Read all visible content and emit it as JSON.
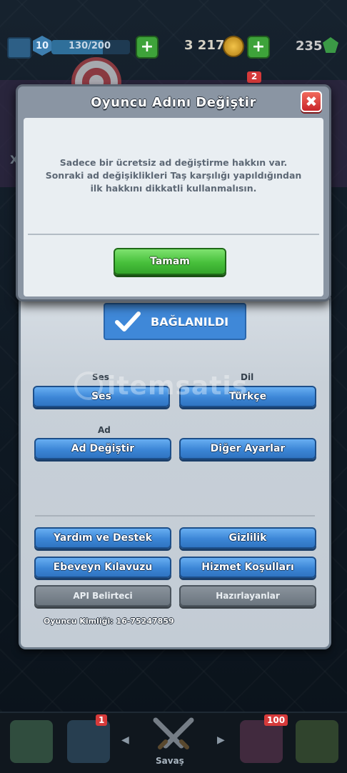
{
  "topbar": {
    "level": "10",
    "xp_text": "130/200",
    "xp_progress": 0.65,
    "gold": "3 217",
    "gems": "235"
  },
  "background": {
    "chest_badge": "2",
    "side_mark": "X"
  },
  "modal": {
    "title": "Oyuncu Adını Değiştir",
    "close_label": "✖",
    "message": "Sadece bir ücretsiz ad değiştirme hakkın var. Sonraki ad değişiklikleri Taş karşılığı yapıldığından ilk hakkını dikkatli kullanmalısın.",
    "ok_label": "Tamam"
  },
  "settings": {
    "connected_label": "BAĞLANILDI",
    "sound_section": "Ses",
    "language_section": "Dil",
    "name_section": "Ad",
    "sound_button": "Ses",
    "language_button": "Türkçe",
    "change_name_button": "Ad Değiştir",
    "other_settings_button": "Diğer Ayarlar",
    "help_button": "Yardım ve Destek",
    "privacy_button": "Gizlilik",
    "parent_guide_button": "Ebeveyn Kılavuzu",
    "terms_button": "Hizmet Koşulları",
    "api_button": "API Belirteci",
    "credits_button": "Hazırlayanlar",
    "player_id": "Oyuncu Kimliği: 16-75247859"
  },
  "watermark": "itemsatis",
  "bottom_nav": {
    "cards_badge": "1",
    "clan_badge": "100",
    "battle_label": "Savaş"
  }
}
